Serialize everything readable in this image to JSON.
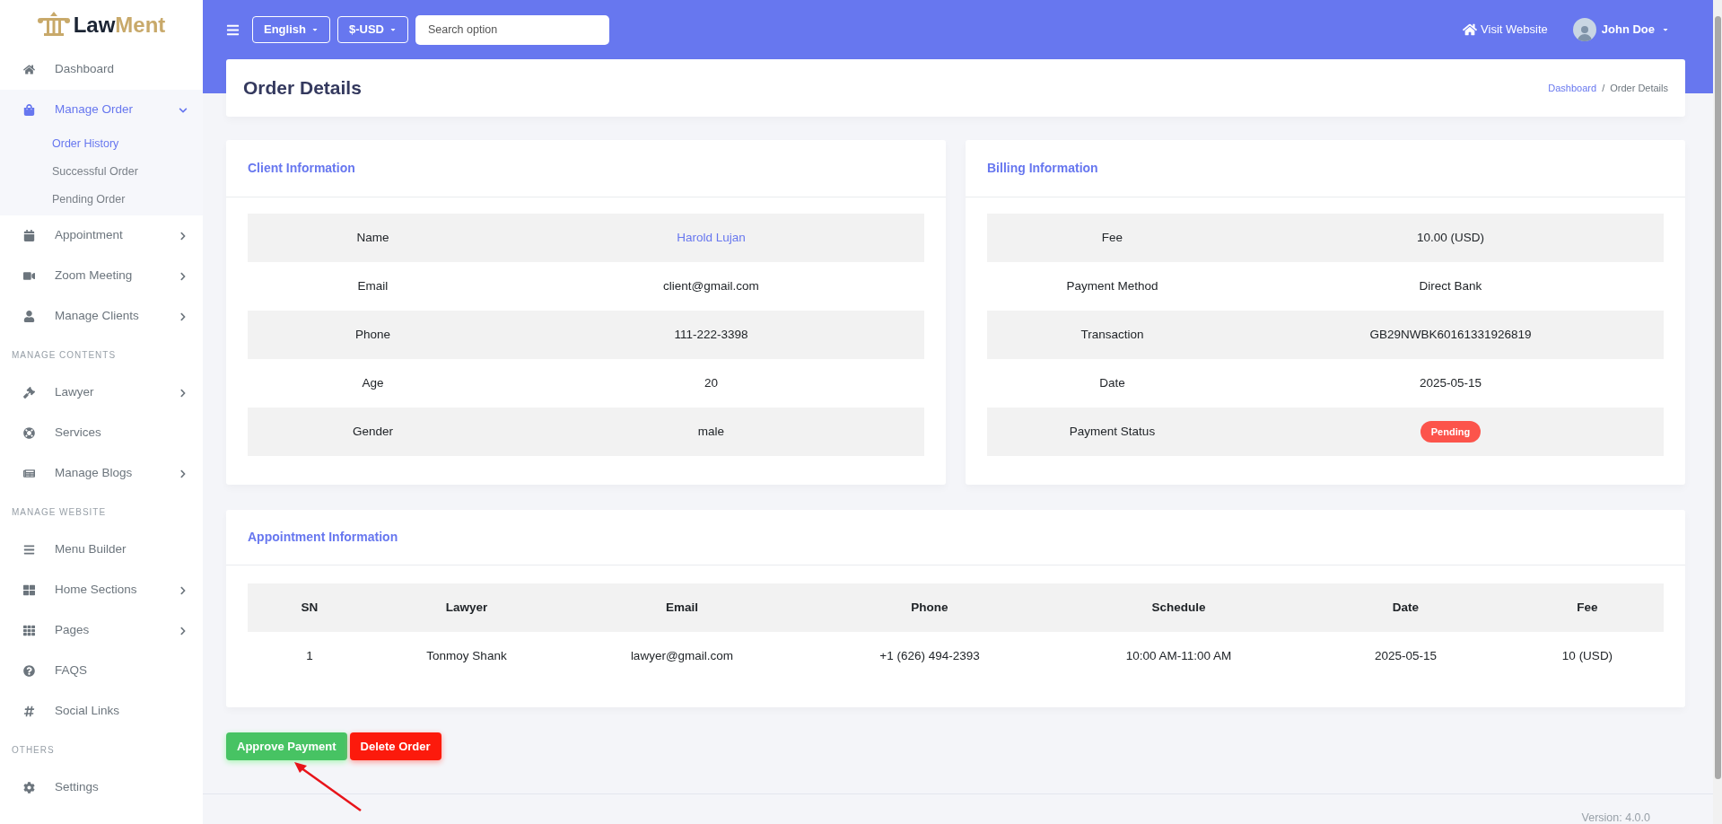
{
  "sidebar": {
    "logo": {
      "part_1": "Law",
      "part_2": "Ment"
    },
    "items": [
      {
        "kind": "item",
        "label": "Dashboard",
        "selected": false
      },
      {
        "kind": "item",
        "label": "Manage Order",
        "selected": true,
        "expanded": true,
        "children": [
          {
            "label": "Order History",
            "selected": true
          },
          {
            "label": "Successful Order",
            "selected": false
          },
          {
            "label": "Pending Order",
            "selected": false
          }
        ]
      },
      {
        "kind": "item",
        "label": "Appointment",
        "selected": false,
        "expanded": false
      },
      {
        "kind": "item",
        "label": "Zoom Meeting",
        "selected": false,
        "expanded": false
      },
      {
        "kind": "item",
        "label": "Manage Clients",
        "selected": false,
        "expanded": false
      },
      {
        "kind": "section",
        "label": "MANAGE CONTENTS"
      },
      {
        "kind": "item",
        "label": "Lawyer",
        "selected": false,
        "expanded": false
      },
      {
        "kind": "item",
        "label": "Services",
        "selected": false
      },
      {
        "kind": "item",
        "label": "Manage Blogs",
        "selected": false,
        "expanded": false
      },
      {
        "kind": "section",
        "label": "MANAGE WEBSITE"
      },
      {
        "kind": "item",
        "label": "Menu Builder",
        "selected": false
      },
      {
        "kind": "item",
        "label": "Home Sections",
        "selected": false,
        "expanded": false
      },
      {
        "kind": "item",
        "label": "Pages",
        "selected": false,
        "expanded": false
      },
      {
        "kind": "item",
        "label": "FAQS",
        "selected": false
      },
      {
        "kind": "item",
        "label": "Social Links",
        "selected": false
      },
      {
        "kind": "section",
        "label": "OTHERS"
      },
      {
        "kind": "item",
        "label": "Settings",
        "selected": false
      }
    ]
  },
  "topbar": {
    "language": "English",
    "currency": "$-USD",
    "search": {
      "placeholder": "Search option"
    },
    "visit_website": "Visit Website",
    "user": "John Doe"
  },
  "page_header": {
    "title": "Order Details",
    "breadcrumb": [
      "Dashboard",
      "Order Details"
    ],
    "breadcrumb_separator": "/"
  },
  "client_info": {
    "title": "Client Information",
    "rows": [
      {
        "label": "Name",
        "value": "Harold Lujan",
        "kind": "link"
      },
      {
        "label": "Email",
        "value": "client@gmail.com",
        "kind": "text"
      },
      {
        "label": "Phone",
        "value": "111-222-3398",
        "kind": "text"
      },
      {
        "label": "Age",
        "value": "20",
        "kind": "text"
      },
      {
        "label": "Gender",
        "value": "male",
        "kind": "text"
      }
    ]
  },
  "billing_info": {
    "title": "Billing Information",
    "rows": [
      {
        "label": "Fee",
        "value": "10.00 (USD)",
        "kind": "text"
      },
      {
        "label": "Payment Method",
        "value": "Direct Bank",
        "kind": "text"
      },
      {
        "label": "Transaction",
        "value": "GB29NWBK60161331926819",
        "kind": "text"
      },
      {
        "label": "Date",
        "value": "2025-05-15",
        "kind": "text"
      },
      {
        "label": "Payment Status",
        "value": "Pending",
        "kind": "badge"
      }
    ]
  },
  "appointment_info": {
    "title": "Appointment Information",
    "columns": [
      "SN",
      "Lawyer",
      "Email",
      "Phone",
      "Schedule",
      "Date",
      "Fee"
    ],
    "rows": [
      [
        "1",
        "Tonmoy Shank",
        "lawyer@gmail.com",
        "+1 (626) 494-2393",
        "10:00 AM-11:00 AM",
        "2025-05-15",
        "10 (USD)"
      ]
    ]
  },
  "actions": [
    {
      "label": "Approve Payment",
      "kind": "approve"
    },
    {
      "label": "Delete Order",
      "kind": "delete"
    }
  ],
  "footer": {
    "version": "Version: 4.0.0"
  }
}
